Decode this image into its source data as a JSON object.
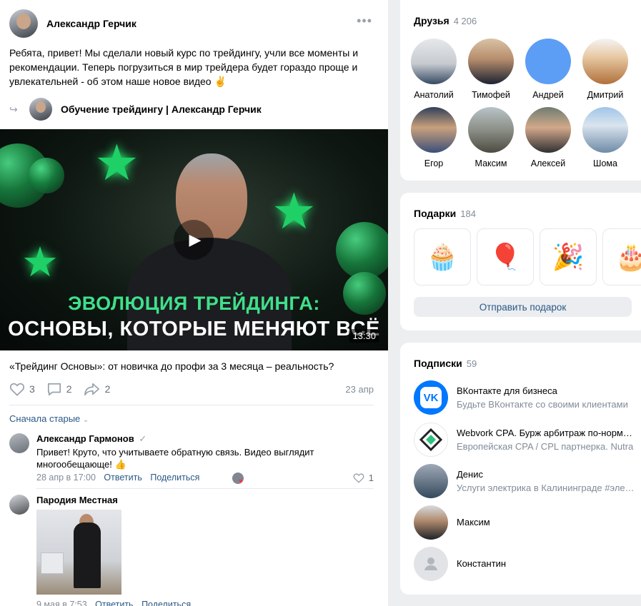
{
  "post": {
    "author": "Александр Герчик",
    "text": "Ребята, привет! Мы сделали новый курс по трейдингу, учли все моменты и рекомендации. Теперь погрузиться в мир трейдера будет гораздо проще и увлекательней - об этом наше новое видео ✌️",
    "repost_title": "Обучение трейдингу | Александр Герчик",
    "video": {
      "title_line1": "ЭВОЛЮЦИЯ ТРЕЙДИНГА:",
      "title_line2": "ОСНОВЫ, КОТОРЫЕ МЕНЯЮТ ВСЁ",
      "duration": "13:30"
    },
    "caption": "«Трейдинг Основы»: от новичка до профи за 3 месяца – реальность?",
    "likes": "3",
    "comments": "2",
    "shares": "2",
    "date": "23 апр",
    "sort_label": "Сначала старые",
    "comment_list": [
      {
        "name": "Александр Гармонов",
        "text": "Привет! Круто, что учитываете обратную связь. Видео выглядит многообещающе! 👍",
        "date": "28 апр в 17:00",
        "reply": "Ответить",
        "share": "Поделиться",
        "likes": "1"
      },
      {
        "name": "Пародия Местная",
        "date": "9 мая в 7:53",
        "reply": "Ответить",
        "share": "Поделиться"
      }
    ]
  },
  "friends": {
    "title": "Друзья",
    "count": "4 206",
    "items": [
      {
        "name": "Анатолий"
      },
      {
        "name": "Тимофей"
      },
      {
        "name": "Андрей"
      },
      {
        "name": "Дмитрий"
      },
      {
        "name": "Егор"
      },
      {
        "name": "Максим"
      },
      {
        "name": "Алексей"
      },
      {
        "name": "Шома"
      }
    ]
  },
  "gifts": {
    "title": "Подарки",
    "count": "184",
    "send_label": "Отправить подарок"
  },
  "subscriptions": {
    "title": "Подписки",
    "count": "59",
    "items": [
      {
        "name": "ВКонтакте для бизнеса",
        "desc": "Будьте ВКонтакте со своими клиентами"
      },
      {
        "name": "Webvork CPA. Бурж арбитраж по-нормальному",
        "desc": "Европейская CPA / CPL партнерка. Nutra"
      },
      {
        "name": "Денис",
        "desc": "Услуги электрика в Калининграде #электрик"
      },
      {
        "name": "Максим"
      },
      {
        "name": "Константин"
      }
    ]
  },
  "colors": {
    "link": "#2a5885",
    "muted": "#818c99",
    "accent_green": "#3fe08a"
  }
}
